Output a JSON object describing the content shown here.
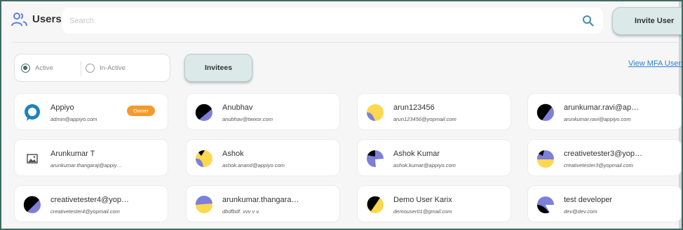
{
  "header": {
    "title": "Users",
    "icon": "users-icon",
    "search": {
      "placeholder": "Search",
      "value": ""
    },
    "invite_label": "Invite User"
  },
  "filters": {
    "active_label": "Active",
    "inactive_label": "In-Active",
    "selected": "Active",
    "invitees_label": "Invitees",
    "mfa_link_label": "View MFA Users"
  },
  "colors": {
    "accent": "#3f6b63",
    "button_bg": "#dbe9e8",
    "owner_badge": "#f39a2b",
    "link": "#2f7fd6",
    "avatar_purple": "#7d7fd8",
    "avatar_yellow": "#fbd84f",
    "avatar_black": "#000000"
  },
  "users": [
    {
      "name": "Appiyo",
      "email": "admin@appiyo.com",
      "badge": "Owner",
      "avatar": "chat-bubble-logo"
    },
    {
      "name": "Anubhav",
      "email": "anubhav@twixor.com",
      "badge": "",
      "avatar": "black-purple"
    },
    {
      "name": "arun123456",
      "email": "arun123456@yopmail.com",
      "badge": "",
      "avatar": "yellow-purple"
    },
    {
      "name": "arunkumar.ravi@ap…",
      "email": "arunkumar.ravi@appiyo.com",
      "badge": "",
      "avatar": "black-purple"
    },
    {
      "name": "Arunkumar T",
      "email": "arunkumar.thangaraj@appiy…",
      "badge": "",
      "avatar": "image-placeholder"
    },
    {
      "name": "Ashok",
      "email": "ashok.anand@appiyo.com",
      "badge": "",
      "avatar": "yellow-purple"
    },
    {
      "name": "Ashok Kumar",
      "email": "ashok.kumar@appiyo.com",
      "badge": "",
      "avatar": "purple-black"
    },
    {
      "name": "creativetester3@yop…",
      "email": "creativetester3@yopmail.com",
      "badge": "",
      "avatar": "purple-yellow"
    },
    {
      "name": "creativetester4@yop…",
      "email": "creativetester4@yopmail.com",
      "badge": "",
      "avatar": "black-purple"
    },
    {
      "name": "arunkumar.thangara…",
      "email": "dbdfbdf. vvv v v.",
      "badge": "",
      "avatar": "purple-yellow-split"
    },
    {
      "name": "Demo User Karix",
      "email": "demouser01@gmail.com",
      "badge": "",
      "avatar": "black-yellow"
    },
    {
      "name": "test developer",
      "email": "dev@dev.com",
      "badge": "",
      "avatar": "purple-black-split"
    }
  ]
}
